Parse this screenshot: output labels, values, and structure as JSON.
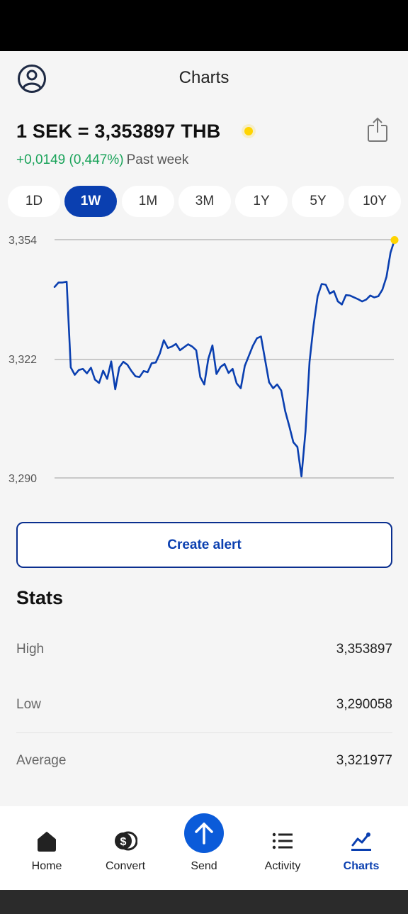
{
  "header": {
    "title": "Charts",
    "profile_icon": "user-circle-icon"
  },
  "rate": {
    "text": "1 SEK = 3,353897 THB",
    "change": "+0,0149 (0,447%)",
    "period": "Past week",
    "indicator_color": "#ffd400",
    "share_icon": "share-icon"
  },
  "periods": {
    "items": [
      "1D",
      "1W",
      "1M",
      "3M",
      "1Y",
      "5Y",
      "10Y"
    ],
    "selected": "1W"
  },
  "chart_data": {
    "type": "line",
    "title": "",
    "xlabel": "",
    "ylabel": "",
    "y_ticks": [
      "3,354",
      "3,322",
      "3,290"
    ],
    "ylim": [
      3.29,
      3.354
    ],
    "grid": true,
    "line_color": "#0a3fb0",
    "marker_color": "#ffd400",
    "series": [
      {
        "values": [
          3.3413,
          3.3425,
          3.3425,
          3.3427,
          3.3197,
          3.3177,
          3.319,
          3.3193,
          3.3181,
          3.3196,
          3.3164,
          3.3155,
          3.3188,
          3.3166,
          3.3213,
          3.3138,
          3.3197,
          3.3212,
          3.3204,
          3.3187,
          3.3173,
          3.3171,
          3.3187,
          3.3184,
          3.3208,
          3.321,
          3.3234,
          3.327,
          3.3249,
          3.3253,
          3.326,
          3.3243,
          3.3251,
          3.3259,
          3.3253,
          3.3243,
          3.3171,
          3.3151,
          3.322,
          3.3256,
          3.3179,
          3.3198,
          3.3206,
          3.3182,
          3.3193,
          3.3154,
          3.3141,
          3.3201,
          3.3228,
          3.3255,
          3.3275,
          3.328,
          3.3219,
          3.3157,
          3.3141,
          3.3151,
          3.3135,
          3.3079,
          3.3039,
          3.2996,
          3.2983,
          3.2904,
          3.3025,
          3.3212,
          3.331,
          3.3388,
          3.3421,
          3.3419,
          3.3395,
          3.3402,
          3.3374,
          3.3366,
          3.3391,
          3.339,
          3.3385,
          3.338,
          3.3374,
          3.3379,
          3.339,
          3.3385,
          3.3388,
          3.3406,
          3.344,
          3.3505,
          3.3539
        ]
      }
    ]
  },
  "actions": {
    "create_alert": "Create alert"
  },
  "stats": {
    "title": "Stats",
    "rows": [
      {
        "label": "High",
        "value": "3,353897"
      },
      {
        "label": "Low",
        "value": "3,290058"
      },
      {
        "label": "Average",
        "value": "3,321977"
      }
    ]
  },
  "nav": {
    "items": [
      {
        "label": "Home",
        "icon": "home-icon"
      },
      {
        "label": "Convert",
        "icon": "coins-icon"
      },
      {
        "label": "Send",
        "icon": "arrow-up-icon"
      },
      {
        "label": "Activity",
        "icon": "list-icon"
      },
      {
        "label": "Charts",
        "icon": "chart-line-icon"
      }
    ],
    "active": "Charts"
  }
}
